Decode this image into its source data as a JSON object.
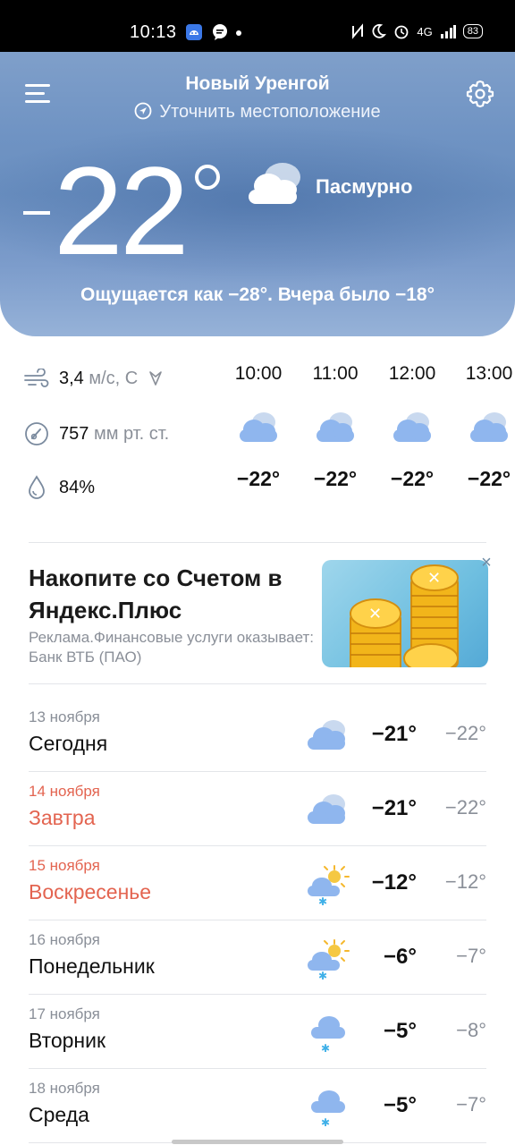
{
  "status_bar": {
    "time": "10:13",
    "network": "4G",
    "battery": "83"
  },
  "header": {
    "city": "Новый Уренгой",
    "locate_label": "Уточнить местоположение"
  },
  "current": {
    "temperature": "22",
    "condition": "Пасмурно",
    "feels_like": "Ощущается как −28°. Вчера было −18°",
    "condition_icon": "overcast-cloud-icon"
  },
  "details": {
    "wind_value": "3,4",
    "wind_unit": "м/с, С",
    "pressure_value": "757",
    "pressure_unit": "мм рт. ст.",
    "humidity": "84%"
  },
  "hourly": [
    {
      "time": "10:00",
      "temp": "−22°",
      "icon": "cloud-icon"
    },
    {
      "time": "11:00",
      "temp": "−22°",
      "icon": "cloud-icon"
    },
    {
      "time": "12:00",
      "temp": "−22°",
      "icon": "cloud-icon"
    },
    {
      "time": "13:00",
      "temp": "−22°",
      "icon": "cloud-icon"
    }
  ],
  "ad": {
    "title": "Накопите со Счетом в Яндекс.Плюс",
    "subtitle": "Реклама.Финансовые услуги оказывает: Банк ВТБ (ПАО)",
    "close_label": "×"
  },
  "forecast": [
    {
      "date": "13 ноября",
      "day": "Сегодня",
      "hi": "−21°",
      "lo": "−22°",
      "icon": "cloud-icon",
      "weekend": false
    },
    {
      "date": "14 ноября",
      "day": "Завтра",
      "hi": "−21°",
      "lo": "−22°",
      "icon": "cloud-icon",
      "weekend": true
    },
    {
      "date": "15 ноября",
      "day": "Воскресенье",
      "hi": "−12°",
      "lo": "−12°",
      "icon": "sun-cloud-snow-icon",
      "weekend": true
    },
    {
      "date": "16 ноября",
      "day": "Понедельник",
      "hi": "−6°",
      "lo": "−7°",
      "icon": "sun-cloud-snow-icon",
      "weekend": false
    },
    {
      "date": "17 ноября",
      "day": "Вторник",
      "hi": "−5°",
      "lo": "−8°",
      "icon": "cloud-snow-icon",
      "weekend": false
    },
    {
      "date": "18 ноября",
      "day": "Среда",
      "hi": "−5°",
      "lo": "−7°",
      "icon": "cloud-snow-icon",
      "weekend": false
    }
  ],
  "colors": {
    "weekend": "#e36450",
    "hero_top": "#7f9fca",
    "icon_cloud": "#8fb6ee"
  }
}
